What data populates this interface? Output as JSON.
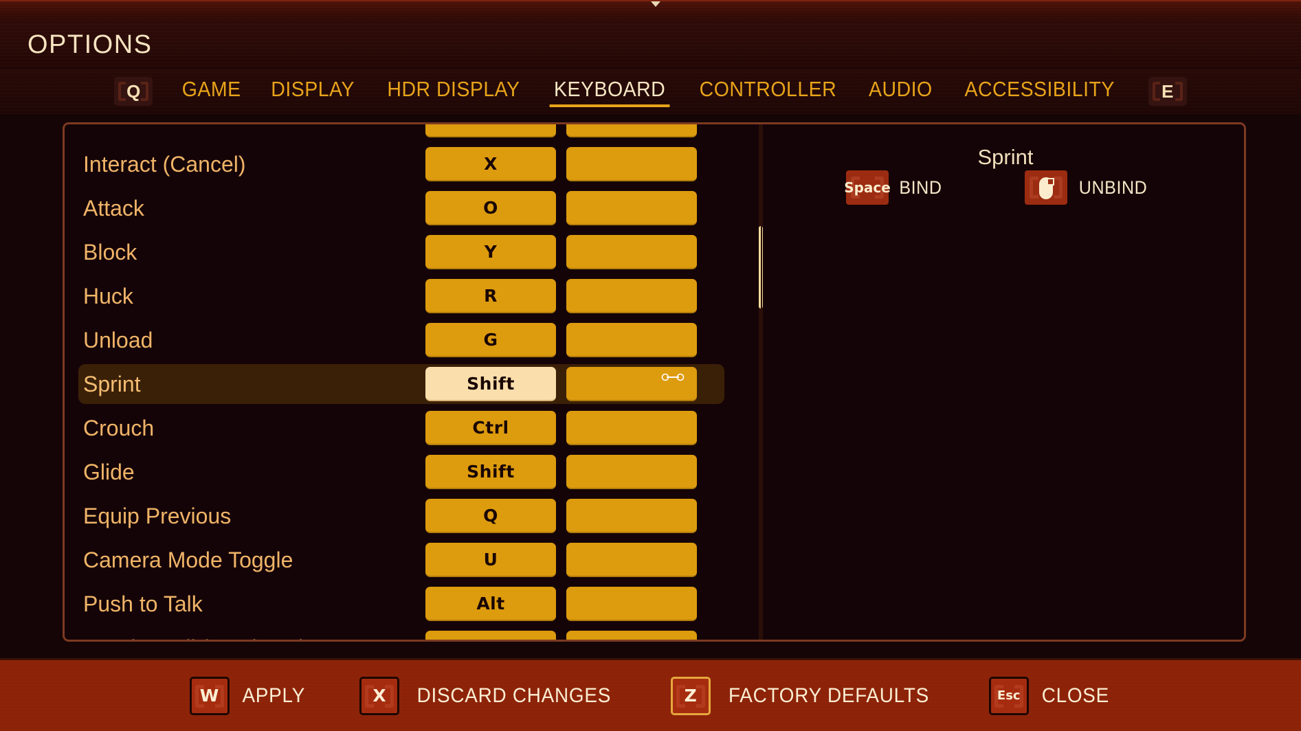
{
  "window": {
    "title": "OPTIONS"
  },
  "tabs": {
    "prev_bumper": "Q",
    "next_bumper": "E",
    "items": [
      {
        "label": "GAME",
        "active": false
      },
      {
        "label": "DISPLAY",
        "active": false
      },
      {
        "label": "HDR DISPLAY",
        "active": false
      },
      {
        "label": "KEYBOARD",
        "active": true
      },
      {
        "label": "CONTROLLER",
        "active": false
      },
      {
        "label": "AUDIO",
        "active": false
      },
      {
        "label": "ACCESSIBILITY",
        "active": false
      }
    ]
  },
  "bindings": {
    "rows": [
      {
        "action": "",
        "primary": "",
        "secondary": "",
        "selected": false,
        "clipped_top": true
      },
      {
        "action": "Interact (Cancel)",
        "primary": "X",
        "secondary": "",
        "selected": false
      },
      {
        "action": "Attack",
        "primary": "O",
        "secondary": "",
        "selected": false
      },
      {
        "action": "Block",
        "primary": "Y",
        "secondary": "",
        "selected": false
      },
      {
        "action": "Huck",
        "primary": "R",
        "secondary": "",
        "selected": false
      },
      {
        "action": "Unload",
        "primary": "G",
        "secondary": "",
        "selected": false
      },
      {
        "action": "Sprint",
        "primary": "Shift",
        "secondary": "",
        "selected": true
      },
      {
        "action": "Crouch",
        "primary": "Ctrl",
        "secondary": "",
        "selected": false
      },
      {
        "action": "Glide",
        "primary": "Shift",
        "secondary": "",
        "selected": false
      },
      {
        "action": "Equip Previous",
        "primary": "Q",
        "secondary": "",
        "selected": false
      },
      {
        "action": "Camera Mode Toggle",
        "primary": "U",
        "secondary": "",
        "selected": false
      },
      {
        "action": "Push to Talk",
        "primary": "Alt",
        "secondary": "",
        "selected": false
      },
      {
        "action": "Toggle Trail / Backpack",
        "primary": "",
        "secondary": "",
        "selected": false,
        "clipped_bottom": true
      }
    ]
  },
  "detail": {
    "title": "Sprint",
    "bind": {
      "key": "Space",
      "label": "BIND",
      "icon": "space-key-icon"
    },
    "unbind": {
      "key": "",
      "label": "UNBIND",
      "icon": "mouse-right-click-icon"
    }
  },
  "footer": {
    "actions": [
      {
        "key": "W",
        "label": "APPLY",
        "highlight": false,
        "small": false
      },
      {
        "key": "X",
        "label": "DISCARD CHANGES",
        "highlight": false,
        "small": false
      },
      {
        "key": "Z",
        "label": "FACTORY DEFAULTS",
        "highlight": true,
        "small": false
      },
      {
        "key": "Esc",
        "label": "CLOSE",
        "highlight": false,
        "small": true
      }
    ]
  },
  "colors": {
    "accent_gold": "#e8a41a",
    "keyslot": "#dd9b0e",
    "keyslot_selected": "#fadeab",
    "row_highlight": "#3b2008",
    "panel_border": "#7d3a21",
    "footer_bg": "#8c2309",
    "text_cream": "#f6e3c0",
    "text_amber": "#f0b468"
  }
}
